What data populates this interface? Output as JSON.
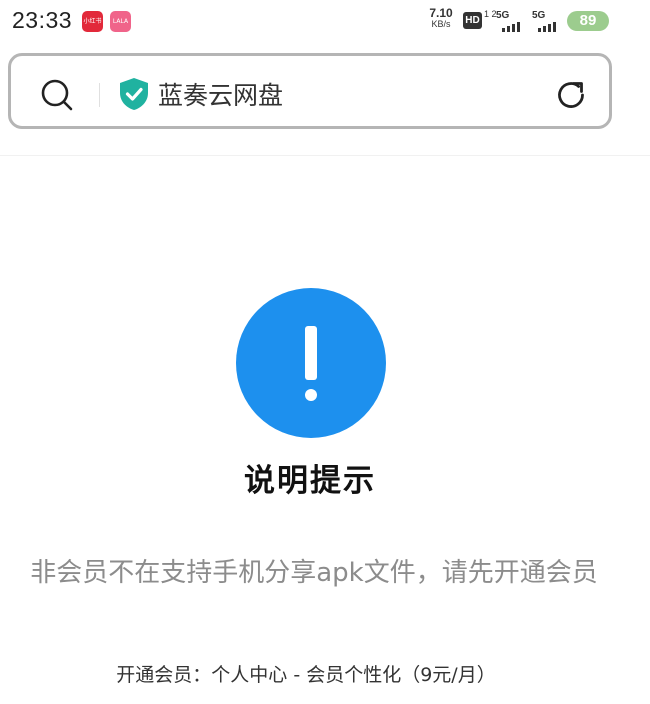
{
  "status_bar": {
    "time": "23:33",
    "app_badges": [
      "小红书",
      "LALA"
    ],
    "network_speed_value": "7.10",
    "network_speed_unit": "KB/s",
    "hd_label": "HD",
    "hd_sub": "1 2",
    "signal_1_label": "5G",
    "signal_2_label": "5G",
    "battery_level": "89",
    "battery_color": "#9ccc8e"
  },
  "address_bar": {
    "search_icon": "search-icon",
    "secure_icon": "shield-check-icon",
    "secure_color": "#20b2a0",
    "title": "蓝奏云网盘",
    "reload_icon": "reload-icon"
  },
  "notice": {
    "icon": "exclamation-circle-icon",
    "icon_color": "#1d90ee",
    "title": "说明提示",
    "message": "非会员不在支持手机分享apk文件，请先开通会员",
    "instruction": "开通会员：个人中心 - 会员个性化（9元/月）"
  }
}
